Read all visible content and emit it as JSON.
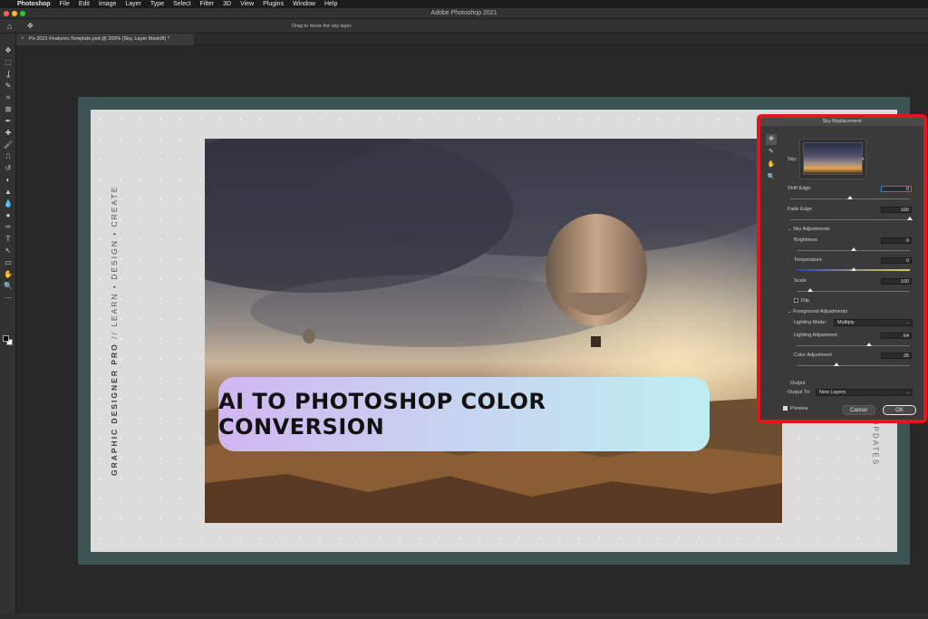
{
  "menubar": {
    "apple": "",
    "items": [
      "Photoshop",
      "File",
      "Edit",
      "Image",
      "Layer",
      "Type",
      "Select",
      "Filter",
      "3D",
      "View",
      "Plugins",
      "Window",
      "Help"
    ]
  },
  "window": {
    "title": "Adobe Photoshop 2021"
  },
  "options_bar": {
    "hint": "Drag to move the sky layer."
  },
  "document_tab": {
    "label": "Ps-2021-Features-Template.psd @ 200% (Sky, Layer Mask/8) *"
  },
  "icons": {
    "home": "⌂",
    "move": "✥",
    "close": "×",
    "tools": [
      "✥",
      "⬚",
      "ʆ",
      "✎",
      "⌗",
      "⊠",
      "✒",
      "✚",
      "🖌",
      "⎍",
      "↺",
      "◐",
      "▲",
      "💧",
      "●",
      "✑",
      "T",
      "↖",
      "▭",
      "✋",
      "🔍",
      "⋯"
    ],
    "dialog_tools": [
      "✥",
      "✎",
      "✋",
      "🔍"
    ]
  },
  "artboard": {
    "vertical_left": "GRAPHIC DESIGNER PRO // LEARN • DESIGN • CREATE",
    "vertical_left_bold": "GRAPHIC DESIGNER PRO",
    "vertical_left_rest": " // LEARN • DESIGN • CREATE",
    "vertical_right": "UPDATES"
  },
  "banner": {
    "text": "AI TO PHOTOSHOP COLOR CONVERSION"
  },
  "sky_dialog": {
    "title": "Sky Replacement",
    "sky_label": "Sky:",
    "shift_edge": {
      "label": "Shift Edge",
      "value": "0",
      "level": 0.5
    },
    "fade_edge": {
      "label": "Fade Edge",
      "value": "100",
      "level": 1.0
    },
    "sky_adjustments": "Sky Adjustments",
    "brightness": {
      "label": "Brightness",
      "value": "0",
      "level": 0.5
    },
    "temperature": {
      "label": "Temperature",
      "value": "0",
      "level": 0.5
    },
    "scale": {
      "label": "Scale",
      "value": "100",
      "level": 0.12
    },
    "flip": "Flip",
    "foreground_adjustments": "Foreground Adjustments",
    "lighting_mode": {
      "label": "Lighting Mode:",
      "value": "Multiply"
    },
    "lighting_adjustment": {
      "label": "Lighting Adjustment",
      "value": "64",
      "level": 0.64
    },
    "color_adjustment": {
      "label": "Color Adjustment",
      "value": "35",
      "level": 0.35
    },
    "output": "Output",
    "output_to": {
      "label": "Output To:",
      "value": "New Layers"
    },
    "preview": "Preview",
    "cancel": "Cancel",
    "ok": "OK"
  },
  "colors": {
    "highlight": "#e3161b",
    "artboard_frame": "#3c5454",
    "banner_start": "#d1b6f2",
    "banner_end": "#bdeef1"
  },
  "status": {
    "text": ""
  }
}
